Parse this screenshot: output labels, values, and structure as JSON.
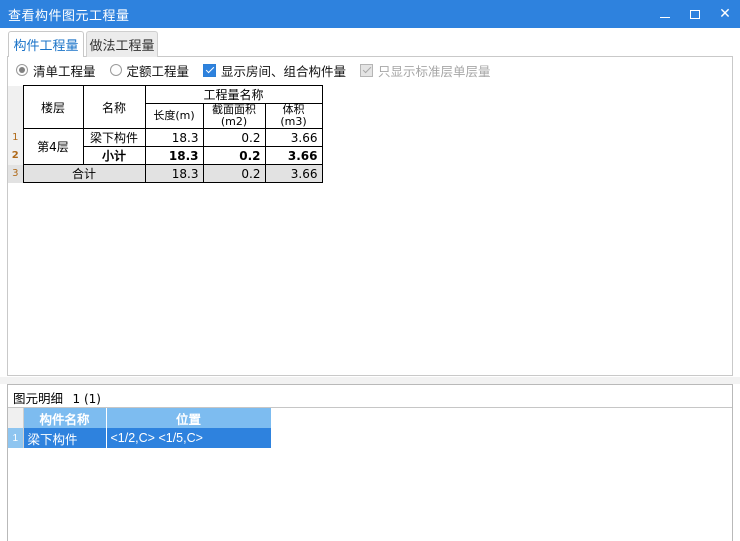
{
  "window": {
    "title": "查看构件图元工程量",
    "controls": [
      {
        "name": "minimize",
        "glyph": "—"
      },
      {
        "name": "maximize",
        "glyph": "□"
      },
      {
        "name": "close",
        "glyph": "✕"
      }
    ]
  },
  "tabs": [
    {
      "label": "构件工程量",
      "active": true
    },
    {
      "label": "做法工程量",
      "active": false
    }
  ],
  "options": {
    "radio_quantity_list": {
      "label": "清单工程量",
      "checked": true
    },
    "radio_quota_quantity": {
      "label": "定额工程量",
      "checked": false
    },
    "checkbox_show_room": {
      "label": "显示房间、组合构件量",
      "checked": true,
      "disabled": false
    },
    "checkbox_standard_floor": {
      "label": "只显示标准层单层量",
      "checked": true,
      "disabled": true
    }
  },
  "quantity_table": {
    "group_header": "工程量名称",
    "headers": {
      "floor": "楼层",
      "name": "名称",
      "length": "长度(m)",
      "section_area": "截面面积(m2)",
      "volume": "体积(m3)"
    },
    "rows": [
      {
        "num": "1",
        "floor": "第4层",
        "name": "梁下构件",
        "length": "18.3",
        "section_area": "0.2",
        "volume": "3.66",
        "style": "normal"
      },
      {
        "num": "2",
        "floor": "",
        "name": "小计",
        "length": "18.3",
        "section_area": "0.2",
        "volume": "3.66",
        "style": "subtotal"
      },
      {
        "num": "3",
        "floor": "合计",
        "name": "",
        "length": "18.3",
        "section_area": "0.2",
        "volume": "3.66",
        "style": "total"
      }
    ]
  },
  "detail_panel": {
    "label": "图元明细",
    "count": "1 (1)",
    "headers": {
      "component_name": "构件名称",
      "position": "位置"
    },
    "rows": [
      {
        "num": "1",
        "component_name": "梁下构件",
        "position": "<1/2,C> <1/5,C>",
        "selected": true
      }
    ]
  },
  "colors": {
    "titlebar": "#2E82DE",
    "accent": "#2E82DE",
    "header_blue": "#7DBCF0",
    "active_tab_text": "#1a73c8",
    "rownum": "#b06a1a",
    "total_row_bg": "#e2e2e2"
  }
}
